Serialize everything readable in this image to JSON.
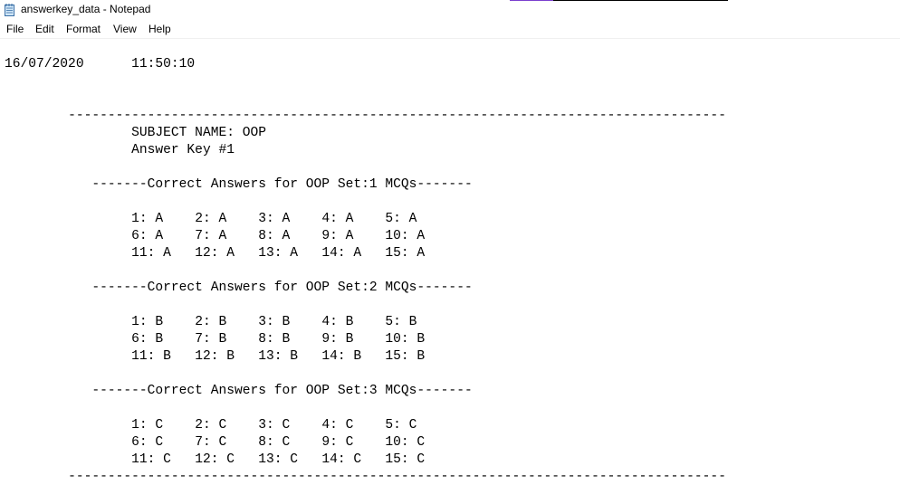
{
  "window": {
    "title": "answerkey_data - Notepad",
    "accent_color": "#7b3fcf"
  },
  "menubar": {
    "items": [
      "File",
      "Edit",
      "Format",
      "View",
      "Help"
    ]
  },
  "editor": {
    "content": "16/07/2020\t11:50:10\n\n\n\t-----------------------------------------------------------------------------------\n\t\tSUBJECT NAME: OOP\n\t\tAnswer Key #1\n\n\t   -------Correct Answers for OOP Set:1 MCQs-------\n\n\t\t1: A\t2: A\t3: A\t4: A\t5: A\n\t\t6: A\t7: A\t8: A\t9: A\t10: A\n\t\t11: A\t12: A\t13: A\t14: A\t15: A\n\n\t   -------Correct Answers for OOP Set:2 MCQs-------\n\n\t\t1: B\t2: B\t3: B\t4: B\t5: B\n\t\t6: B\t7: B\t8: B\t9: B\t10: B\n\t\t11: B\t12: B\t13: B\t14: B\t15: B\n\n\t   -------Correct Answers for OOP Set:3 MCQs-------\n\n\t\t1: C\t2: C\t3: C\t4: C\t5: C\n\t\t6: C\t7: C\t8: C\t9: C\t10: C\n\t\t11: C\t12: C\t13: C\t14: C\t15: C\n\t-----------------------------------------------------------------------------------"
  }
}
